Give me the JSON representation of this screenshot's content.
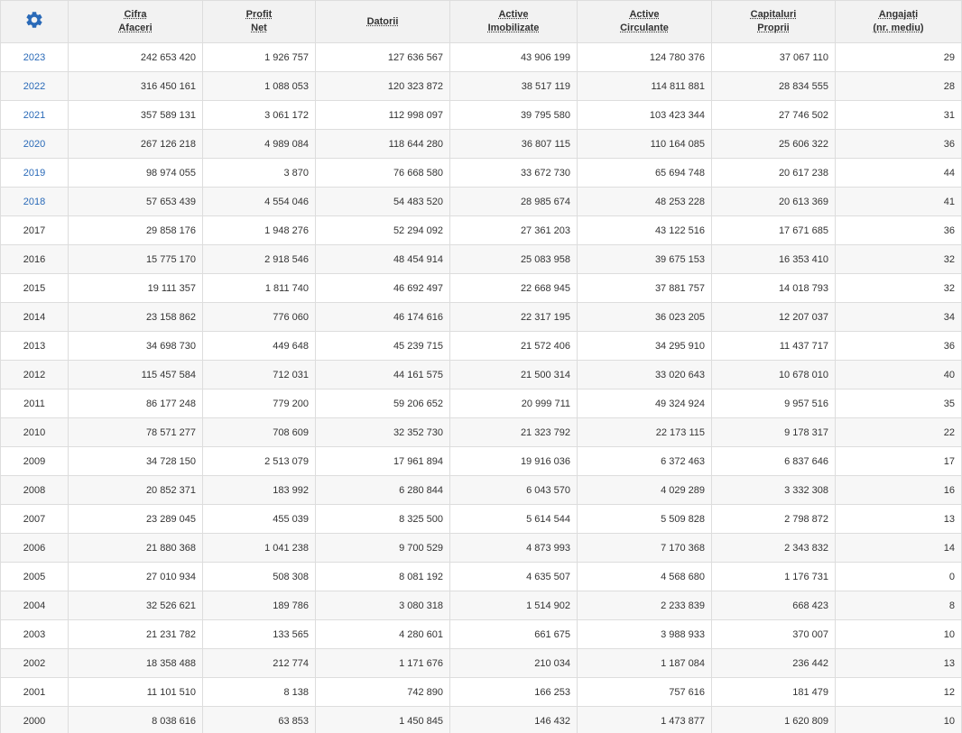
{
  "colors": {
    "accent": "#2a6ab8",
    "header_bg": "#f2f2f2",
    "row_alt": "#f7f7f7",
    "border": "#dddddd"
  },
  "header": {
    "settings_icon": "gear-icon",
    "columns": [
      {
        "key": "cifra_afaceri",
        "lines": [
          "Cifra",
          "Afaceri"
        ]
      },
      {
        "key": "profit_net",
        "lines": [
          "Profit",
          "Net"
        ]
      },
      {
        "key": "datorii",
        "lines": [
          "Datorii"
        ]
      },
      {
        "key": "active_imobilizate",
        "lines": [
          "Active",
          "Imobilizate"
        ]
      },
      {
        "key": "active_circulante",
        "lines": [
          "Active",
          "Circulante"
        ]
      },
      {
        "key": "capitaluri_proprii",
        "lines": [
          "Capitaluri",
          "Proprii"
        ]
      },
      {
        "key": "angajati",
        "lines": [
          "Angajați",
          "(nr. mediu)"
        ]
      }
    ]
  },
  "rows": [
    {
      "year": "2023",
      "link": true,
      "values": [
        "242 653 420",
        "1 926 757",
        "127 636 567",
        "43 906 199",
        "124 780 376",
        "37 067 110",
        "29"
      ]
    },
    {
      "year": "2022",
      "link": true,
      "values": [
        "316 450 161",
        "1 088 053",
        "120 323 872",
        "38 517 119",
        "114 811 881",
        "28 834 555",
        "28"
      ]
    },
    {
      "year": "2021",
      "link": true,
      "values": [
        "357 589 131",
        "3 061 172",
        "112 998 097",
        "39 795 580",
        "103 423 344",
        "27 746 502",
        "31"
      ]
    },
    {
      "year": "2020",
      "link": true,
      "values": [
        "267 126 218",
        "4 989 084",
        "118 644 280",
        "36 807 115",
        "110 164 085",
        "25 606 322",
        "36"
      ]
    },
    {
      "year": "2019",
      "link": true,
      "values": [
        "98 974 055",
        "3 870",
        "76 668 580",
        "33 672 730",
        "65 694 748",
        "20 617 238",
        "44"
      ]
    },
    {
      "year": "2018",
      "link": true,
      "values": [
        "57 653 439",
        "4 554 046",
        "54 483 520",
        "28 985 674",
        "48 253 228",
        "20 613 369",
        "41"
      ]
    },
    {
      "year": "2017",
      "link": false,
      "values": [
        "29 858 176",
        "1 948 276",
        "52 294 092",
        "27 361 203",
        "43 122 516",
        "17 671 685",
        "36"
      ]
    },
    {
      "year": "2016",
      "link": false,
      "values": [
        "15 775 170",
        "2 918 546",
        "48 454 914",
        "25 083 958",
        "39 675 153",
        "16 353 410",
        "32"
      ]
    },
    {
      "year": "2015",
      "link": false,
      "values": [
        "19 111 357",
        "1 811 740",
        "46 692 497",
        "22 668 945",
        "37 881 757",
        "14 018 793",
        "32"
      ]
    },
    {
      "year": "2014",
      "link": false,
      "values": [
        "23 158 862",
        "776 060",
        "46 174 616",
        "22 317 195",
        "36 023 205",
        "12 207 037",
        "34"
      ]
    },
    {
      "year": "2013",
      "link": false,
      "values": [
        "34 698 730",
        "449 648",
        "45 239 715",
        "21 572 406",
        "34 295 910",
        "11 437 717",
        "36"
      ]
    },
    {
      "year": "2012",
      "link": false,
      "values": [
        "115 457 584",
        "712 031",
        "44 161 575",
        "21 500 314",
        "33 020 643",
        "10 678 010",
        "40"
      ]
    },
    {
      "year": "2011",
      "link": false,
      "values": [
        "86 177 248",
        "779 200",
        "59 206 652",
        "20 999 711",
        "49 324 924",
        "9 957 516",
        "35"
      ]
    },
    {
      "year": "2010",
      "link": false,
      "values": [
        "78 571 277",
        "708 609",
        "32 352 730",
        "21 323 792",
        "22 173 115",
        "9 178 317",
        "22"
      ]
    },
    {
      "year": "2009",
      "link": false,
      "values": [
        "34 728 150",
        "2 513 079",
        "17 961 894",
        "19 916 036",
        "6 372 463",
        "6 837 646",
        "17"
      ]
    },
    {
      "year": "2008",
      "link": false,
      "values": [
        "20 852 371",
        "183 992",
        "6 280 844",
        "6 043 570",
        "4 029 289",
        "3 332 308",
        "16"
      ]
    },
    {
      "year": "2007",
      "link": false,
      "values": [
        "23 289 045",
        "455 039",
        "8 325 500",
        "5 614 544",
        "5 509 828",
        "2 798 872",
        "13"
      ]
    },
    {
      "year": "2006",
      "link": false,
      "values": [
        "21 880 368",
        "1 041 238",
        "9 700 529",
        "4 873 993",
        "7 170 368",
        "2 343 832",
        "14"
      ]
    },
    {
      "year": "2005",
      "link": false,
      "values": [
        "27 010 934",
        "508 308",
        "8 081 192",
        "4 635 507",
        "4 568 680",
        "1 176 731",
        "0"
      ]
    },
    {
      "year": "2004",
      "link": false,
      "values": [
        "32 526 621",
        "189 786",
        "3 080 318",
        "1 514 902",
        "2 233 839",
        "668 423",
        "8"
      ]
    },
    {
      "year": "2003",
      "link": false,
      "values": [
        "21 231 782",
        "133 565",
        "4 280 601",
        "661 675",
        "3 988 933",
        "370 007",
        "10"
      ]
    },
    {
      "year": "2002",
      "link": false,
      "values": [
        "18 358 488",
        "212 774",
        "1 171 676",
        "210 034",
        "1 187 084",
        "236 442",
        "13"
      ]
    },
    {
      "year": "2001",
      "link": false,
      "values": [
        "11 101 510",
        "8 138",
        "742 890",
        "166 253",
        "757 616",
        "181 479",
        "12"
      ]
    },
    {
      "year": "2000",
      "link": false,
      "values": [
        "8 038 616",
        "63 853",
        "1 450 845",
        "146 432",
        "1 473 877",
        "1 620 809",
        "10"
      ]
    }
  ]
}
